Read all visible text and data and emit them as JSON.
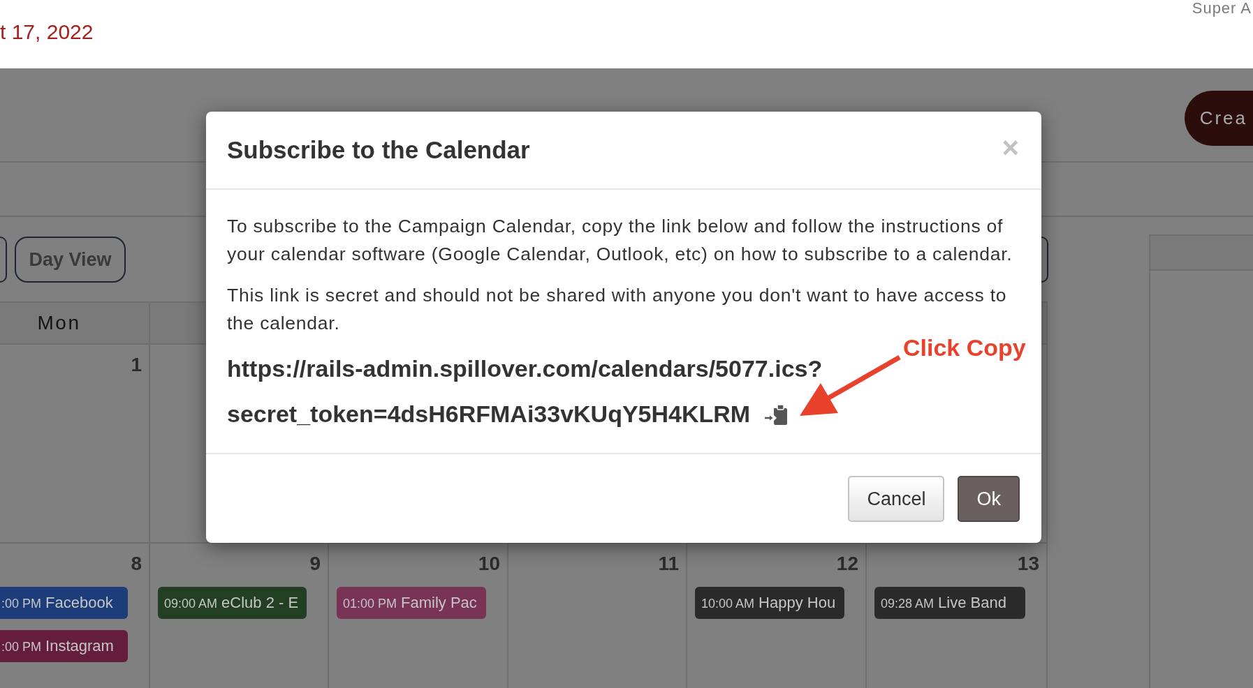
{
  "header": {
    "date": "t 17, 2022",
    "user": "Super A"
  },
  "toolbar": {
    "create_button": "Crea"
  },
  "view_buttons": [
    "Day View"
  ],
  "calendar": {
    "weekdays": [
      "Mon"
    ],
    "weeks": [
      {
        "days": [
          {
            "date": "1"
          }
        ]
      },
      {
        "days": [
          {
            "date": "8",
            "events": [
              {
                "time": ":00 PM",
                "title": "Facebook",
                "color": "#1c3d7a"
              },
              {
                "time": ":00 PM",
                "title": "Instagram",
                "color": "#641d3d"
              }
            ]
          },
          {
            "date": "9",
            "events": [
              {
                "time": "09:00 AM",
                "title": "eClub 2 - E",
                "color": "#233f21"
              }
            ]
          },
          {
            "date": "10",
            "events": [
              {
                "time": "01:00 PM",
                "title": "Family Pac",
                "color": "#793355"
              }
            ]
          },
          {
            "date": "11"
          },
          {
            "date": "12",
            "events": [
              {
                "time": "10:00 AM",
                "title": "Happy Hou",
                "color": "#2a2a2a"
              }
            ]
          },
          {
            "date": "13",
            "events": [
              {
                "time": "09:28 AM",
                "title": "Live Band",
                "color": "#2a2a2a"
              }
            ]
          }
        ]
      }
    ]
  },
  "dialog": {
    "title": "Subscribe to the Calendar",
    "close_label": "×",
    "paragraphs": [
      "To subscribe to the Campaign Calendar, copy the link below and follow the instructions of your calendar software (Google Calendar, Outlook, etc) on how to subscribe to a calendar.",
      "This link is secret and should not be shared with anyone you don't want to have access to the calendar."
    ],
    "url_lines": [
      "https://rails-admin.spillover.com/calendars/5077.ics?",
      "secret_token=4dsH6RFMAi33vKUqY5H4KLRM"
    ],
    "annotation": "Click Copy",
    "buttons": [
      {
        "label": "Cancel",
        "kind": "secondary"
      },
      {
        "label": "Ok",
        "kind": "primary"
      }
    ]
  }
}
